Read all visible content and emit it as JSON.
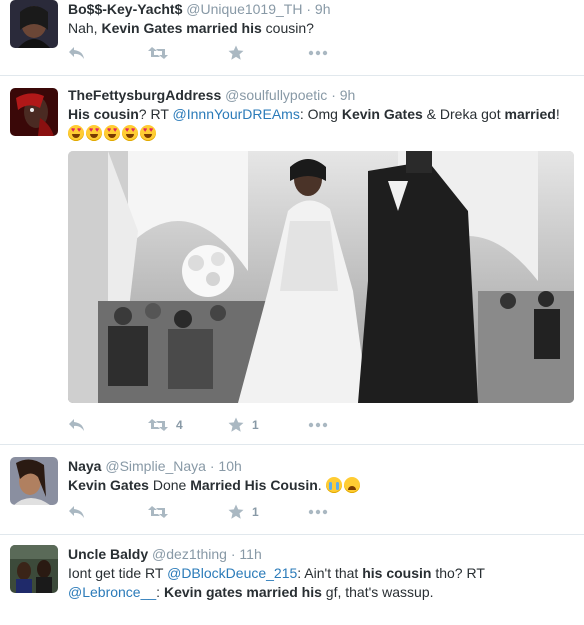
{
  "tweets": [
    {
      "fullname": "Bo$$-Key-Yacht$",
      "handle": "@Unique1019_TH",
      "separator": "·",
      "time": "9h",
      "text_parts": [
        "Nah, ",
        "Kevin Gates married his",
        " cousin?"
      ],
      "retweets": "",
      "favorites": ""
    },
    {
      "fullname": "TheFettysburgAddress",
      "handle": "@soulfullypoetic",
      "separator": "·",
      "time": "9h",
      "text_parts": [
        "His cousin",
        "? RT ",
        "@InnnYourDREAms",
        ": Omg ",
        "Kevin Gates",
        " & Dreka got ",
        "married",
        "!"
      ],
      "emoji": [
        "heart-eyes-emoji",
        "heart-eyes-emoji",
        "heart-eyes-emoji",
        "heart-eyes-emoji",
        "heart-eyes-emoji"
      ],
      "media": "wedding-photo",
      "retweets": "4",
      "favorites": "1"
    },
    {
      "fullname": "Naya",
      "handle": "@Simplie_Naya",
      "separator": "·",
      "time": "10h",
      "text_parts": [
        "Kevin Gates",
        " Done ",
        "Married His Cousin",
        "."
      ],
      "emoji": [
        "crying-face-emoji",
        "weary-face-emoji"
      ],
      "retweets": "",
      "favorites": "1"
    },
    {
      "fullname": "Uncle Baldy",
      "handle": "@dez1thing",
      "separator": "·",
      "time": "11h",
      "text_parts": [
        "Iont get tide RT ",
        "@DBlockDeuce_215",
        ": Ain't that ",
        "his cousin",
        " tho? RT ",
        "@Lebronce__",
        ": ",
        "Kevin gates married his",
        " gf, that's wassup."
      ]
    }
  ],
  "icons": {
    "reply": "reply-icon",
    "retweet": "retweet-icon",
    "favorite": "star-icon",
    "more": "more-icon"
  },
  "colors": {
    "link": "#2b7bb9",
    "muted": "#8899a6",
    "icon": "#aab8c2",
    "border": "#e1e8ed"
  }
}
